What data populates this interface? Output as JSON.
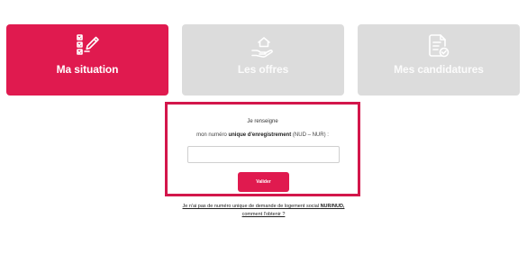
{
  "tabs": [
    {
      "label": "Ma situation",
      "icon": "checklist-pen-icon",
      "active": true
    },
    {
      "label": "Les offres",
      "icon": "hand-house-icon",
      "active": false
    },
    {
      "label": "Mes candidatures",
      "icon": "document-check-icon",
      "active": false
    }
  ],
  "form": {
    "title": "Je renseigne",
    "prompt_prefix": "mon numéro",
    "prompt_strong": "unique d'enregistrement",
    "prompt_suffix": "(NUD – NUR) :",
    "input_value": "",
    "submit_label": "Valider"
  },
  "help": {
    "line1_prefix": "Je n'ai pas de numéro unique de demande de logement social",
    "line1_strong": "NUR/NUD,",
    "line2": "comment l'obtenir ?"
  },
  "colors": {
    "accent": "#e01a4f",
    "frame": "#d3164b",
    "inactive_tab": "#dcdcdc"
  }
}
